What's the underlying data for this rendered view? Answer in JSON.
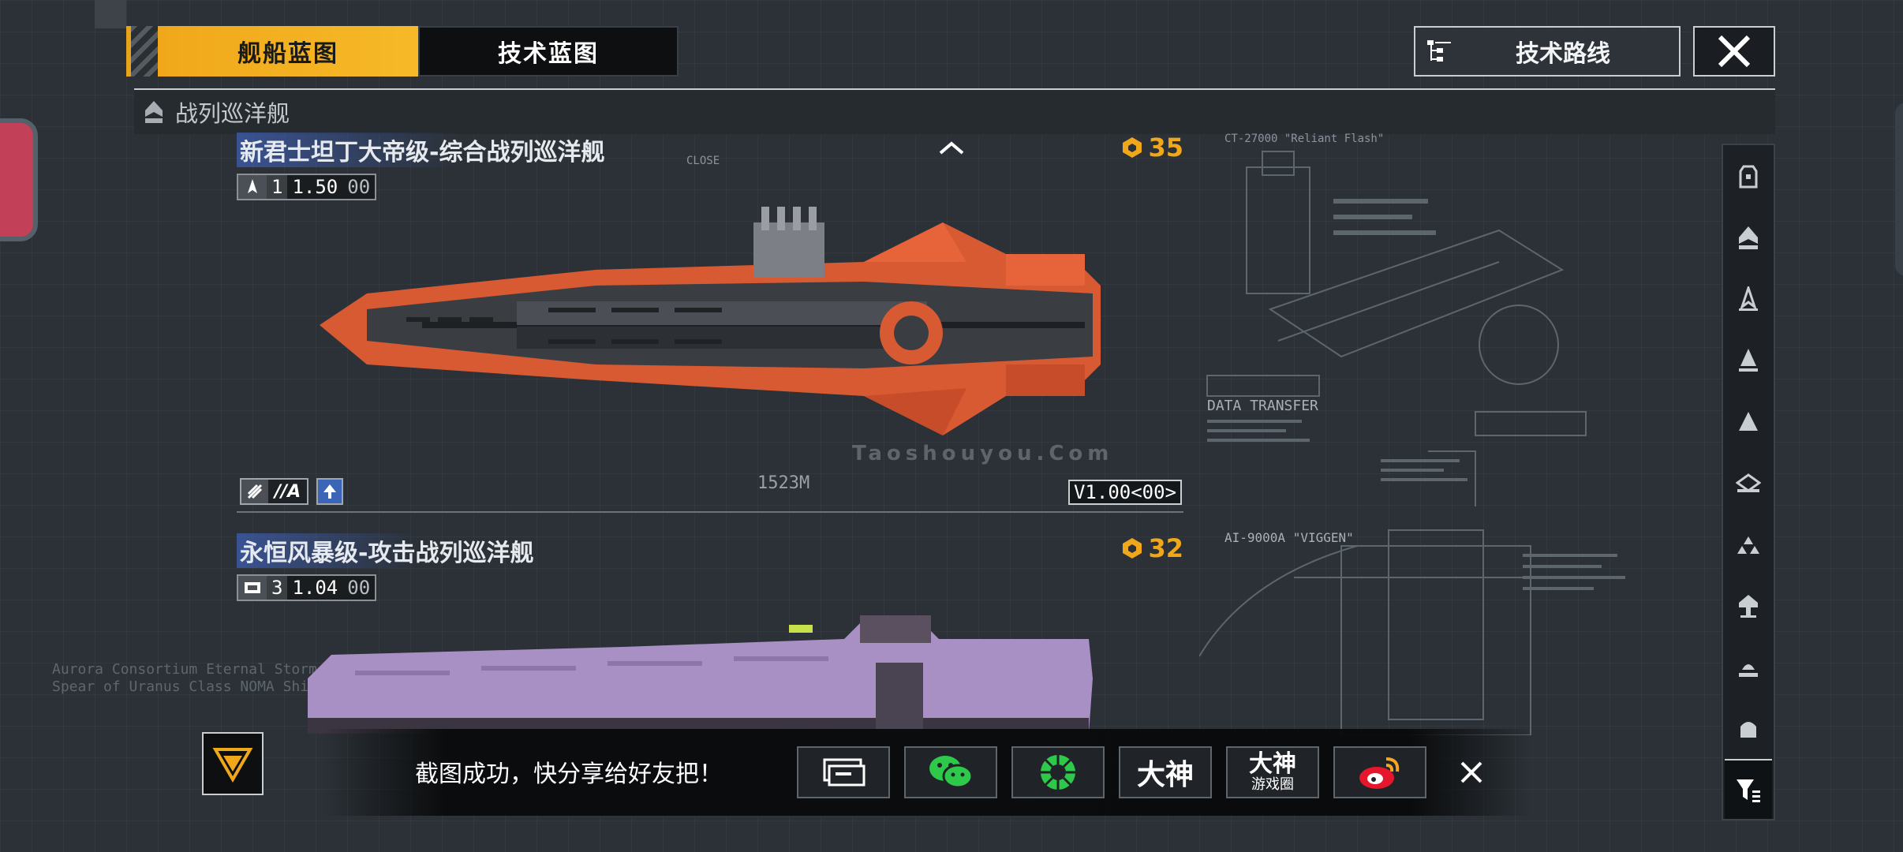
{
  "tabs": {
    "ship_blueprint": "舰船蓝图",
    "tech_blueprint": "技术蓝图"
  },
  "tech_route": {
    "label": "技术路线",
    "icon": "tree-list-icon"
  },
  "category": {
    "label": "战列巡洋舰",
    "icon": "ship-class-icon"
  },
  "ships": [
    {
      "name": "新君士坦丁大帝级-综合战列巡洋舰",
      "spec_count": "1",
      "spec_value": "1.50",
      "spec_suffix": "00",
      "cost": "35",
      "length": "1523M",
      "role_tag": "//A",
      "version": "V1.00<00>",
      "hull_color": "#e7643a"
    },
    {
      "name": "永恒风暴级-攻击战列巡洋舰",
      "spec_count": "3",
      "spec_value": "1.04",
      "spec_suffix": "00",
      "cost": "32",
      "hull_color": "#a890c4"
    }
  ],
  "blueprint_labels": {
    "data_transfer": "DATA TRANSFER",
    "viggen": "AI-9000A \"VIGGEN\"",
    "reliant": "CT-27000 \"Reliant Flash\"",
    "close": "CLOSE",
    "watermark": "Taoshouyou.Com",
    "left_note_1": "Aurora Consortium Eternal Storm Class",
    "left_note_2": "Spear of Uranus Class NOMA Shipping Group"
  },
  "share": {
    "message": "截图成功，快分享给好友把！",
    "buttons": [
      {
        "name": "screenshot-share-button",
        "icon": "screen-icon"
      },
      {
        "name": "wechat-share-button",
        "icon": "wechat-icon"
      },
      {
        "name": "moments-share-button",
        "icon": "moments-icon"
      },
      {
        "name": "dashen-share-button",
        "label": "大神"
      },
      {
        "name": "dashen-circle-share-button",
        "label": "大神",
        "sub": "游戏圈"
      },
      {
        "name": "weibo-share-button",
        "icon": "weibo-icon"
      }
    ]
  },
  "colors": {
    "accent": "#f0a81a",
    "panel": "#2b3137"
  }
}
